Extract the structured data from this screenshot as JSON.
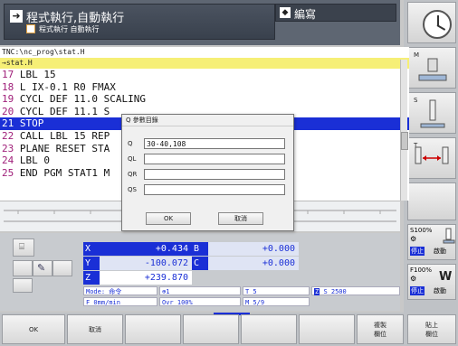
{
  "header": {
    "mode_title": "程式執行,自動執行",
    "mode_subtitle": "程式執行 自動執行",
    "edit_label": "編寫"
  },
  "program": {
    "path": "TNC:\\nc_prog\\stat.H",
    "file_line": "→stat.H",
    "lines": [
      {
        "num": "17",
        "text": "LBL 15"
      },
      {
        "num": "18",
        "text": "L IX-0.1 R0 FMAX"
      },
      {
        "num": "19",
        "text": "CYCL DEF 11.0 SCALING"
      },
      {
        "num": "20",
        "text": "CYCL DEF 11.1 S"
      },
      {
        "num": "21",
        "text": "STOP"
      },
      {
        "num": "22",
        "text": "CALL LBL 15 REP"
      },
      {
        "num": "23",
        "text": "PLANE RESET STA"
      },
      {
        "num": "24",
        "text": "LBL 0"
      },
      {
        "num": "25",
        "text": "END PGM STAT1 M"
      }
    ]
  },
  "dialog": {
    "title": "Q 參數目錄",
    "fields": [
      {
        "label": "Q",
        "value": "30-40,108"
      },
      {
        "label": "QL",
        "value": ""
      },
      {
        "label": "QR",
        "value": ""
      },
      {
        "label": "QS",
        "value": ""
      }
    ],
    "ok_label": "OK",
    "cancel_label": "取消"
  },
  "axes": [
    {
      "letter": "X",
      "value": "+0.434"
    },
    {
      "letter": "Y",
      "value": "-100.072"
    },
    {
      "letter": "Z",
      "value": "+239.870"
    },
    {
      "letter": "B",
      "value": "+0.000"
    },
    {
      "letter": "C",
      "value": "+0.000"
    }
  ],
  "status": {
    "mode": "Mode: 命令",
    "tool_icon_value": "1",
    "tool": "T 5",
    "spindle_label": "S 2500",
    "feed": "F 0mm/min",
    "override": "Ovr 100%",
    "mcode": "M 5/9"
  },
  "right_panel": {
    "m_label": "M",
    "s_label": "S",
    "t_label": "T",
    "s_override": "S100%",
    "stop_label": "停止",
    "start_label": "啟動",
    "f_override": "F100%",
    "stop_label2": "停止",
    "start_label2": "啟動"
  },
  "softkeys": {
    "ok": "OK",
    "cancel": "取消",
    "copy_line1": "複製",
    "copy_line2": "欄位",
    "paste_line1": "貼上",
    "paste_line2": "欄位"
  }
}
